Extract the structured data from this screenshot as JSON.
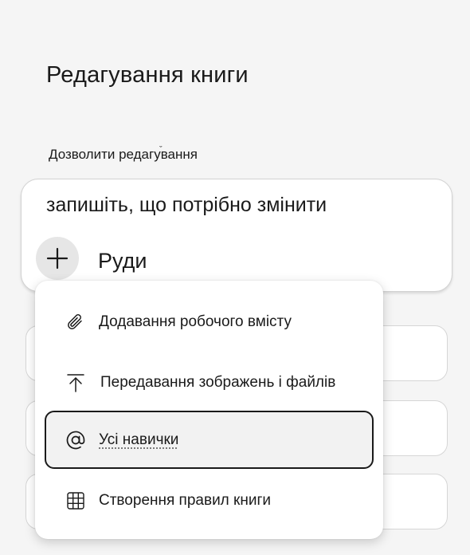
{
  "header": {
    "title": "Редагування книги"
  },
  "section": {
    "label": "Дозволити редагування"
  },
  "compose": {
    "text": "запишіть, що потрібно змінити",
    "mention": "Руди",
    "add_button_icon": "plus-icon"
  },
  "menu": {
    "items": [
      {
        "label": "Додавання робочого вмісту",
        "icon": "paperclip-icon"
      },
      {
        "label": "Передавання зображень і файлів",
        "icon": "upload-icon"
      },
      {
        "label": "Усі навички",
        "icon": "at-sign-icon",
        "selected": true
      },
      {
        "label": "Створення правил книги",
        "icon": "table-grid-icon"
      }
    ]
  }
}
